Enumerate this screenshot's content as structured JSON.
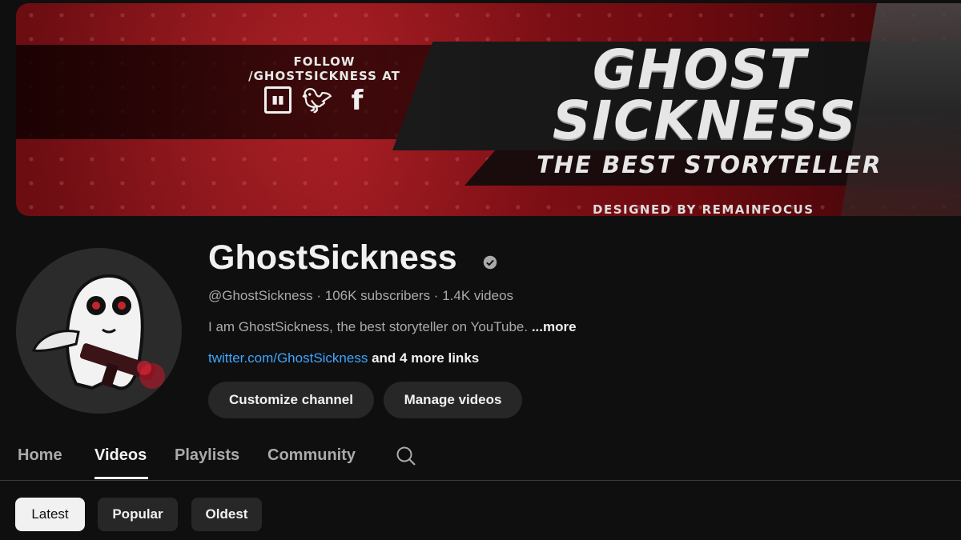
{
  "banner": {
    "follow_line1": "FOLLOW",
    "follow_line2": "/GHOSTSICKNESS AT",
    "social_icons": [
      "twitch-icon",
      "twitter-icon",
      "facebook-icon"
    ],
    "title_line1": "GHOST",
    "title_line2": "SICKNESS",
    "tagline": "THE BEST STORYTELLER",
    "credit": "DESIGNED BY REMAINFOCUS"
  },
  "channel": {
    "name": "GhostSickness",
    "verified": true,
    "meta": "@GhostSickness · 106K subscribers · 1.4K videos",
    "description": "I am GhostSickness, the best storyteller on YouTube. ",
    "more_label": "...more",
    "link_text": "twitter.com/GhostSickness",
    "more_links": " and 4 more links"
  },
  "actions": {
    "customize": "Customize channel",
    "manage": "Manage videos"
  },
  "tabs": [
    {
      "label": "Home",
      "active": false
    },
    {
      "label": "Videos",
      "active": true
    },
    {
      "label": "Playlists",
      "active": false
    },
    {
      "label": "Community",
      "active": false
    }
  ],
  "chips": [
    {
      "label": "Latest",
      "selected": true
    },
    {
      "label": "Popular",
      "selected": false
    },
    {
      "label": "Oldest",
      "selected": false
    }
  ],
  "colors": {
    "background": "#0f0f0f",
    "link": "#3ea6ff",
    "chip": "#272727",
    "banner_red": "#8e141b"
  }
}
